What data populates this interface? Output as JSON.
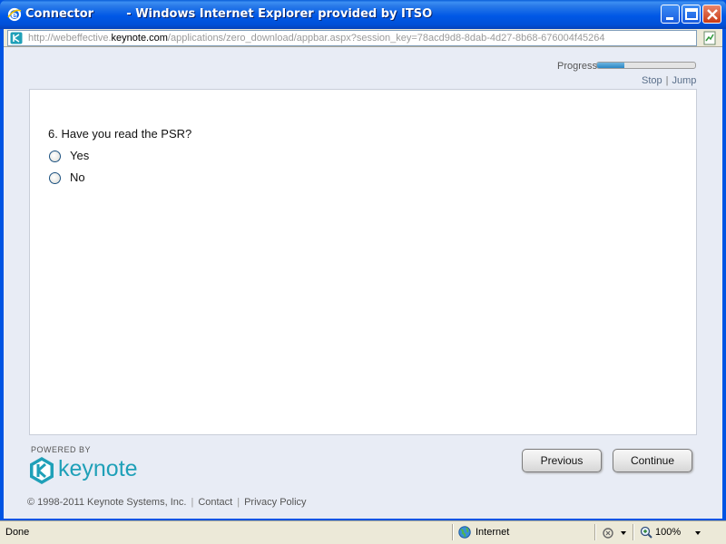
{
  "window": {
    "title": "Connector        - Windows Internet Explorer provided by ITSO",
    "app_icon": "ie-icon",
    "buttons": [
      "minimize-icon",
      "maximize-icon",
      "close-icon"
    ]
  },
  "address": {
    "prefix": "http://webeffective.",
    "host": "keynote.com",
    "path": "/applications/zero_download/appbar.aspx?session_key=78acd9d8-8dab-4d27-8b68-676004f45264"
  },
  "progress": {
    "label": "Progress",
    "fraction": 0.28,
    "stop": "Stop",
    "separator": "|",
    "jump": "Jump"
  },
  "question": {
    "text": "6. Have you read the PSR?",
    "options": [
      {
        "label": "Yes"
      },
      {
        "label": "No"
      }
    ]
  },
  "branding": {
    "powered_by": "POWERED BY",
    "wordmark": "keynote",
    "accent": "#1fa0b8"
  },
  "nav": {
    "previous": "Previous",
    "continue": "Continue"
  },
  "footer": {
    "copyright": "© 1998-2011 Keynote Systems, Inc.",
    "contact": "Contact",
    "privacy": "Privacy Policy",
    "separator": "|"
  },
  "status": {
    "text": "Done",
    "zone": "Internet",
    "zoom": "100%"
  }
}
